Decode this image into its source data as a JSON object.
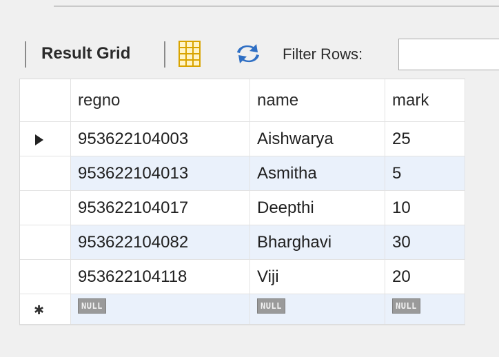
{
  "toolbar": {
    "result_grid_label": "Result Grid",
    "filter_label": "Filter Rows:",
    "filter_value": ""
  },
  "grid": {
    "columns": [
      "regno",
      "name",
      "mark"
    ],
    "rows": [
      {
        "regno": "953622104003",
        "name": "Aishwarya",
        "mark": "25"
      },
      {
        "regno": "953622104013",
        "name": "Asmitha",
        "mark": "5"
      },
      {
        "regno": "953622104017",
        "name": "Deepthi",
        "mark": "10"
      },
      {
        "regno": "953622104082",
        "name": "Bharghavi",
        "mark": "30"
      },
      {
        "regno": "953622104118",
        "name": "Viji",
        "mark": "20"
      }
    ],
    "new_row": {
      "regno": "NULL",
      "name": "NULL",
      "mark": "NULL"
    }
  }
}
